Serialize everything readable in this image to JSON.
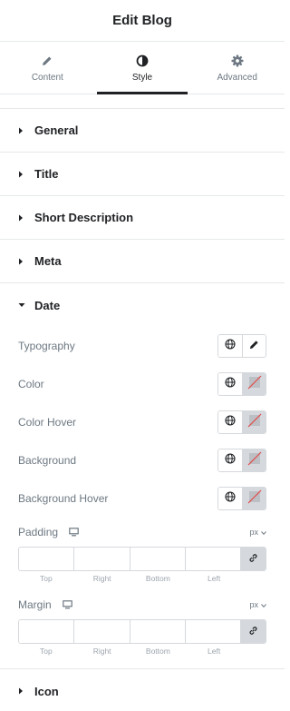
{
  "header": {
    "title": "Edit Blog"
  },
  "tabs": [
    {
      "label": "Content",
      "icon": "pencil-icon",
      "active": false
    },
    {
      "label": "Style",
      "icon": "contrast-icon",
      "active": true
    },
    {
      "label": "Advanced",
      "icon": "gear-icon",
      "active": false
    }
  ],
  "sections": {
    "general": "General",
    "title": "Title",
    "short_description": "Short Description",
    "meta": "Meta",
    "date": "Date",
    "icon": "Icon"
  },
  "date": {
    "typography": "Typography",
    "color": "Color",
    "color_hover": "Color Hover",
    "background": "Background",
    "background_hover": "Background Hover",
    "padding": {
      "label": "Padding",
      "unit": "px",
      "top": "",
      "right": "",
      "bottom": "",
      "left": "",
      "labels": {
        "top": "Top",
        "right": "Right",
        "bottom": "Bottom",
        "left": "Left"
      }
    },
    "margin": {
      "label": "Margin",
      "unit": "px",
      "top": "",
      "right": "",
      "bottom": "",
      "left": "",
      "labels": {
        "top": "Top",
        "right": "Right",
        "bottom": "Bottom",
        "left": "Left"
      }
    }
  },
  "colors": {
    "text": "#1f2124",
    "muted": "#6d7882",
    "border": "#e6e8ea",
    "swatch": "#d5d8dc",
    "unset_slash": "#e34a4a"
  }
}
